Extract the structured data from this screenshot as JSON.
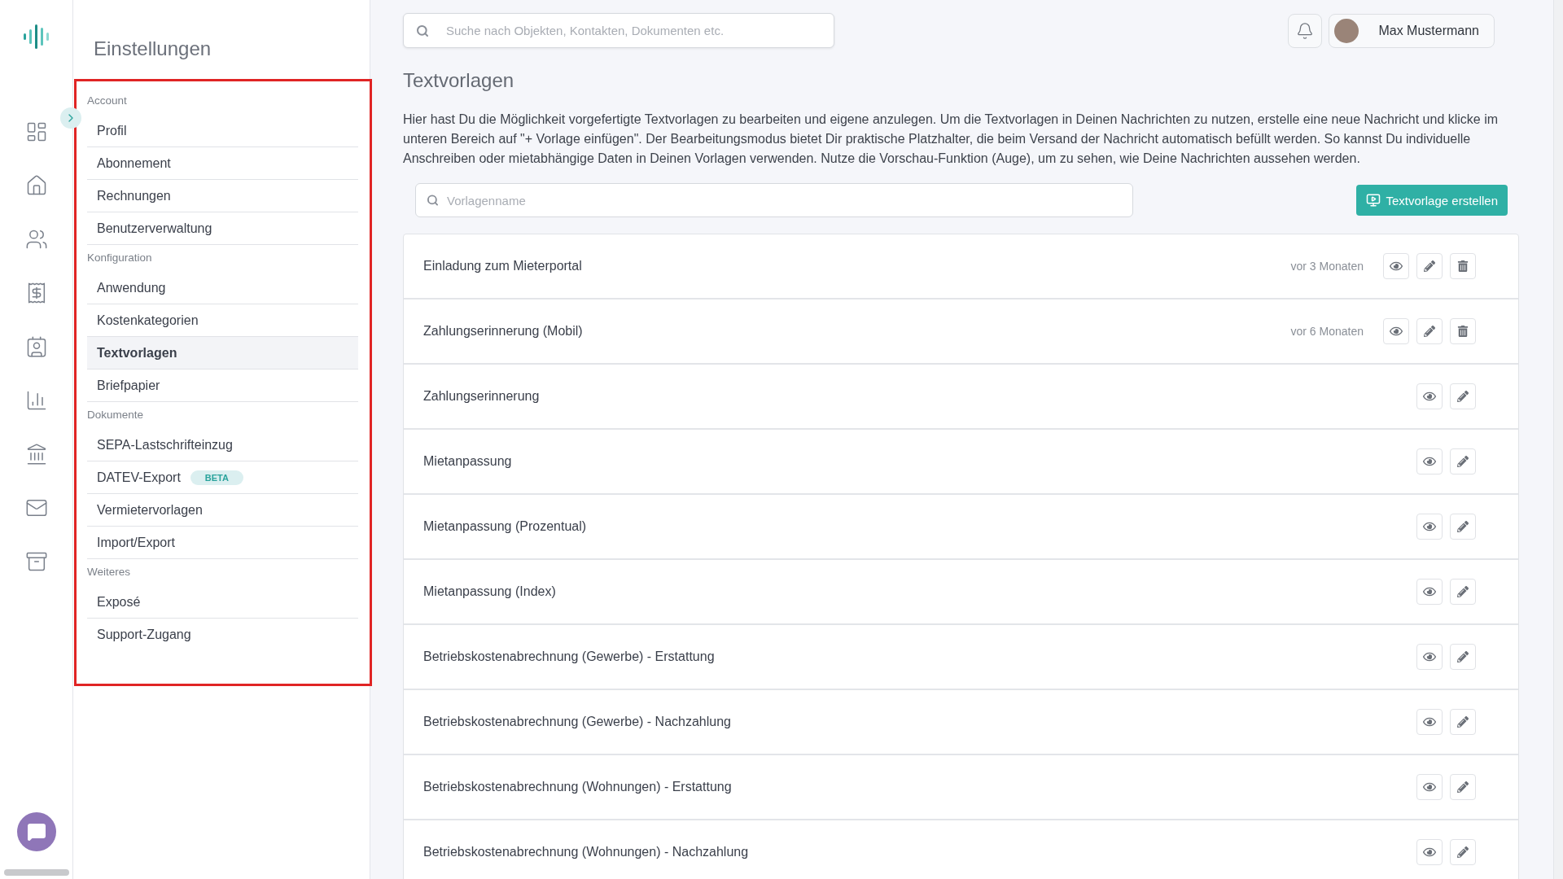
{
  "sidebar": {
    "title": "Einstellungen",
    "sections": [
      {
        "label": "Account",
        "items": [
          {
            "label": "Profil",
            "selected": false
          },
          {
            "label": "Abonnement",
            "selected": false
          },
          {
            "label": "Rechnungen",
            "selected": false
          },
          {
            "label": "Benutzerverwaltung",
            "selected": false
          }
        ]
      },
      {
        "label": "Konfiguration",
        "items": [
          {
            "label": "Anwendung",
            "selected": false
          },
          {
            "label": "Kostenkategorien",
            "selected": false
          },
          {
            "label": "Textvorlagen",
            "selected": true
          },
          {
            "label": "Briefpapier",
            "selected": false
          }
        ]
      },
      {
        "label": "Dokumente",
        "items": [
          {
            "label": "SEPA-Lastschrifteinzug",
            "selected": false
          },
          {
            "label": "DATEV-Export",
            "selected": false,
            "badge": "BETA"
          },
          {
            "label": "Vermietervorlagen",
            "selected": false
          },
          {
            "label": "Import/Export",
            "selected": false
          }
        ]
      },
      {
        "label": "Weiteres",
        "items": [
          {
            "label": "Exposé",
            "selected": false
          },
          {
            "label": "Support-Zugang",
            "selected": false
          }
        ]
      }
    ]
  },
  "header": {
    "search": {
      "placeholder": "Suche nach Objekten, Kontakten, Dokumenten etc."
    },
    "user": "Max Mustermann"
  },
  "page": {
    "title": "Textvorlagen",
    "description": "Hier hast Du die Möglichkeit vorgefertigte Textvorlagen zu bearbeiten und eigene anzulegen. Um die Textvorlagen in Deinen Nachrichten zu nutzen, erstelle eine neue Nachricht und klicke im unteren Bereich auf \"+ Vorlage einfügen\". Der Bearbeitungsmodus bietet Dir praktische Platzhalter, die beim Versand der Nachricht automatisch befüllt werden. So kannst Du individuelle Anschreiben oder mietabhängige Daten in Deinen Vorlagen verwenden. Nutze die Vorschau-Funktion (Auge), um zu sehen, wie Deine Nachrichten aussehen werden.",
    "filter": {
      "placeholder": "Vorlagenname"
    },
    "create_button": "Textvorlage erstellen"
  },
  "templates": [
    {
      "name": "Einladung zum Mieterportal",
      "date": "vor 3 Monaten",
      "deletable": true
    },
    {
      "name": "Zahlungserinnerung (Mobil)",
      "date": "vor 6 Monaten",
      "deletable": true
    },
    {
      "name": "Zahlungserinnerung",
      "deletable": false
    },
    {
      "name": "Mietanpassung",
      "deletable": false
    },
    {
      "name": "Mietanpassung (Prozentual)",
      "deletable": false
    },
    {
      "name": "Mietanpassung (Index)",
      "deletable": false
    },
    {
      "name": "Betriebskostenabrechnung (Gewerbe) - Erstattung",
      "deletable": false
    },
    {
      "name": "Betriebskostenabrechnung (Gewerbe) - Nachzahlung",
      "deletable": false
    },
    {
      "name": "Betriebskostenabrechnung (Wohnungen) - Erstattung",
      "deletable": false
    },
    {
      "name": "Betriebskostenabrechnung (Wohnungen) - Nachzahlung",
      "deletable": false
    }
  ]
}
